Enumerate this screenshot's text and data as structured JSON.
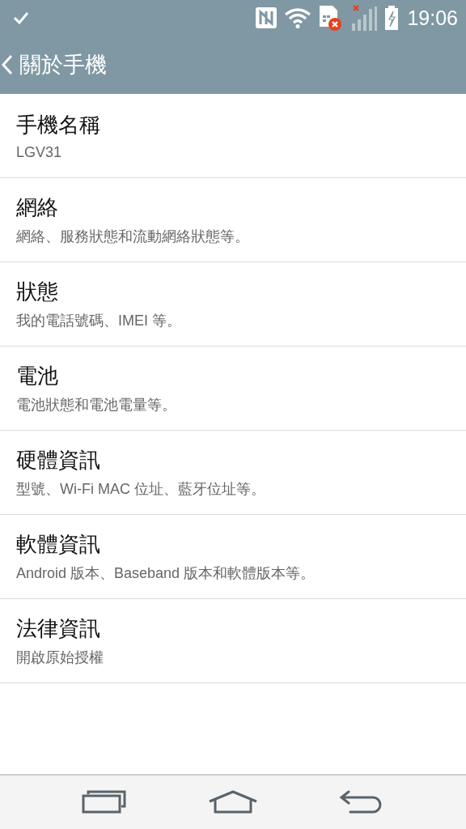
{
  "status_bar": {
    "time": "19:06"
  },
  "header": {
    "title": "關於手機"
  },
  "items": [
    {
      "title": "手機名稱",
      "subtitle": "LGV31"
    },
    {
      "title": "網絡",
      "subtitle": "網絡、服務狀態和流動網絡狀態等。"
    },
    {
      "title": "狀態",
      "subtitle": "我的電話號碼、IMEI 等。"
    },
    {
      "title": "電池",
      "subtitle": "電池狀態和電池電量等。"
    },
    {
      "title": "硬體資訊",
      "subtitle": "型號、Wi-Fi MAC 位址、藍牙位址等。"
    },
    {
      "title": "軟體資訊",
      "subtitle": "Android 版本、Baseband 版本和軟體版本等。"
    },
    {
      "title": "法律資訊",
      "subtitle": "開啟原始授權"
    }
  ]
}
